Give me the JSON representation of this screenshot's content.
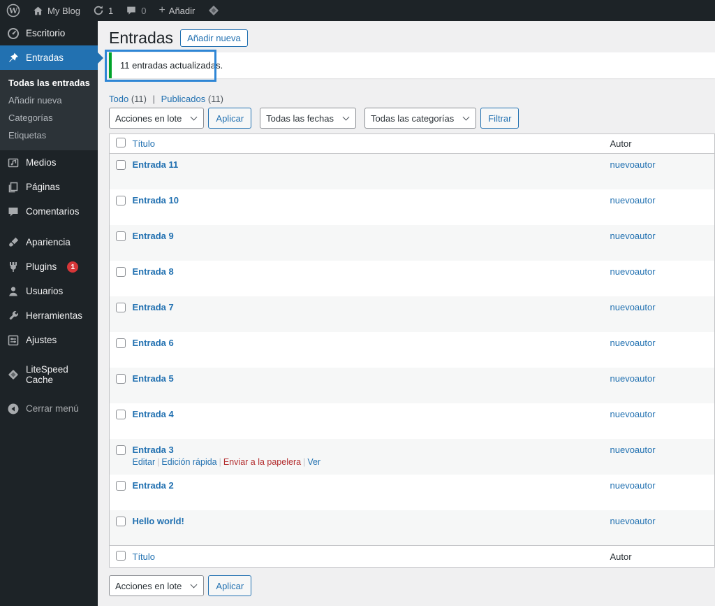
{
  "admin_bar": {
    "site_name": "My Blog",
    "updates_count": "1",
    "comments_count": "0",
    "new_label": "Añadir"
  },
  "sidebar": {
    "items": [
      {
        "label": "Escritorio",
        "icon": "dashboard-gauge"
      },
      {
        "label": "Entradas",
        "icon": "pushpin",
        "active": true
      },
      {
        "label": "Medios",
        "icon": "framed-note"
      },
      {
        "label": "Páginas",
        "icon": "stacked-pages"
      },
      {
        "label": "Comentarios",
        "icon": "speech-bubble"
      },
      {
        "label": "Apariencia",
        "icon": "paintbrush"
      },
      {
        "label": "Plugins",
        "icon": "plug",
        "badge": "1"
      },
      {
        "label": "Usuarios",
        "icon": "person"
      },
      {
        "label": "Herramientas",
        "icon": "wrench"
      },
      {
        "label": "Ajustes",
        "icon": "sliders-panel"
      },
      {
        "label": "LiteSpeed Cache",
        "icon": "diamond"
      },
      {
        "label": "Cerrar menú",
        "icon": "circle-left-arrow"
      }
    ],
    "submenu": [
      {
        "label": "Todas las entradas",
        "current": true
      },
      {
        "label": "Añadir nueva"
      },
      {
        "label": "Categorías"
      },
      {
        "label": "Etiquetas"
      }
    ]
  },
  "page": {
    "title": "Entradas",
    "add_new_label": "Añadir nueva",
    "notice_text": "11 entradas actualizadas.",
    "views": [
      {
        "label": "Todo",
        "count": "(11)"
      },
      {
        "label": "Publicados",
        "count": "(11)"
      }
    ],
    "views_separator": "|",
    "bulk_actions_label": "Acciones en lote",
    "apply_label": "Aplicar",
    "dates_filter_label": "Todas las fechas",
    "categories_filter_label": "Todas las categorías",
    "filter_label": "Filtrar"
  },
  "table": {
    "columns": {
      "title": "Título",
      "author": "Autor"
    },
    "rows": [
      {
        "title": "Entrada 11",
        "author": "nuevoautor"
      },
      {
        "title": "Entrada 10",
        "author": "nuevoautor"
      },
      {
        "title": "Entrada 9",
        "author": "nuevoautor"
      },
      {
        "title": "Entrada 8",
        "author": "nuevoautor"
      },
      {
        "title": "Entrada 7",
        "author": "nuevoautor"
      },
      {
        "title": "Entrada 6",
        "author": "nuevoautor"
      },
      {
        "title": "Entrada 5",
        "author": "nuevoautor"
      },
      {
        "title": "Entrada 4",
        "author": "nuevoautor"
      },
      {
        "title": "Entrada 3",
        "author": "nuevoautor",
        "actions": [
          {
            "label": "Editar",
            "type": "edit"
          },
          {
            "label": "Edición rápida",
            "type": "quick-edit"
          },
          {
            "label": "Enviar a la papelera",
            "type": "trash"
          },
          {
            "label": "Ver",
            "type": "view"
          }
        ]
      },
      {
        "title": "Entrada 2",
        "author": "nuevoautor"
      },
      {
        "title": "Hello world!",
        "author": "nuevoautor"
      }
    ]
  },
  "icons": {
    "wordpress-logo": "W-in-circle",
    "home": "house",
    "updates": "circular-arrow",
    "comments": "speech-bubble",
    "add-new": "+",
    "litespeed": "diamond",
    "chevron-down": "v-caret"
  },
  "colors": {
    "accent_blue": "#2271b1",
    "admin_dark": "#1d2327",
    "submenu_dark": "#2c3338",
    "content_bg": "#f0f0f1",
    "row_stripe": "#f6f7f7",
    "notice_green": "#00a32a",
    "plugin_badge_red": "#d63638",
    "trash_link_red": "#b32d2e",
    "annotation_blue": "#2e86d5"
  }
}
